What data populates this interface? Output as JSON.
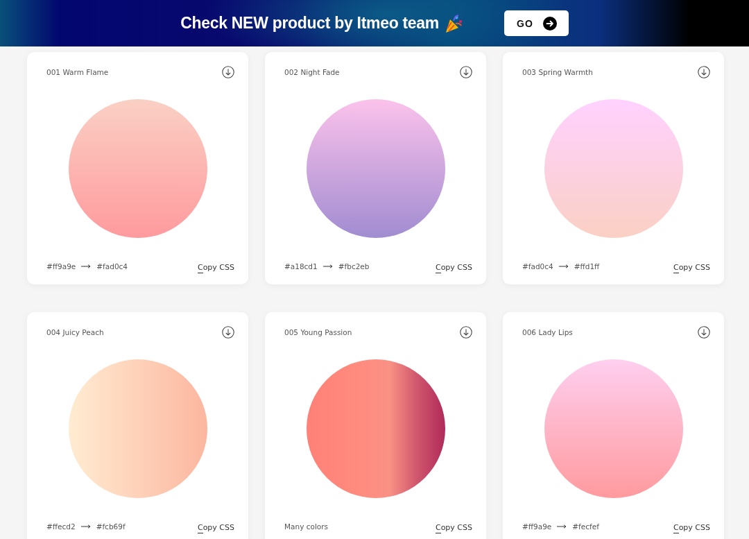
{
  "banner": {
    "text": "Check NEW product by Itmeo team",
    "button": "GO"
  },
  "cards": [
    {
      "title": "001 Warm Flame",
      "kind": "vertical",
      "caption": {
        "kind": "pair",
        "from": "#ff9a9e",
        "to": "#fad0c4"
      },
      "action": "Copy CSS"
    },
    {
      "title": "002 Night Fade",
      "kind": "vertical",
      "caption": {
        "kind": "pair",
        "from": "#a18cd1",
        "to": "#fbc2eb"
      },
      "action": "Copy CSS"
    },
    {
      "title": "003 Spring Warmth",
      "kind": "vertical",
      "caption": {
        "kind": "pair",
        "from": "#fad0c4",
        "to": "#ffd1ff"
      },
      "action": "Copy CSS"
    },
    {
      "title": "004 Juicy Peach",
      "kind": "horizontal",
      "caption": {
        "kind": "pair",
        "from": "#ffecd2",
        "to": "#fcb69f"
      },
      "action": "Copy CSS"
    },
    {
      "title": "005 Young Passion",
      "kind": "horizontal",
      "stops": [
        {
          "color": "#ff8177"
        },
        {
          "color": "#ff867a"
        },
        {
          "color": "#ff8c7f"
        },
        {
          "color": "#f99185"
        },
        {
          "color": "#cf556c"
        },
        {
          "color": "#b12a5b"
        }
      ],
      "caption": {
        "kind": "text",
        "text": "Many colors"
      },
      "action": "Copy CSS"
    },
    {
      "title": "006 Lady Lips",
      "kind": "vertical",
      "caption": {
        "kind": "pair",
        "from": "#ff9a9e",
        "to": "#fecfef"
      },
      "action": "Copy CSS"
    }
  ]
}
